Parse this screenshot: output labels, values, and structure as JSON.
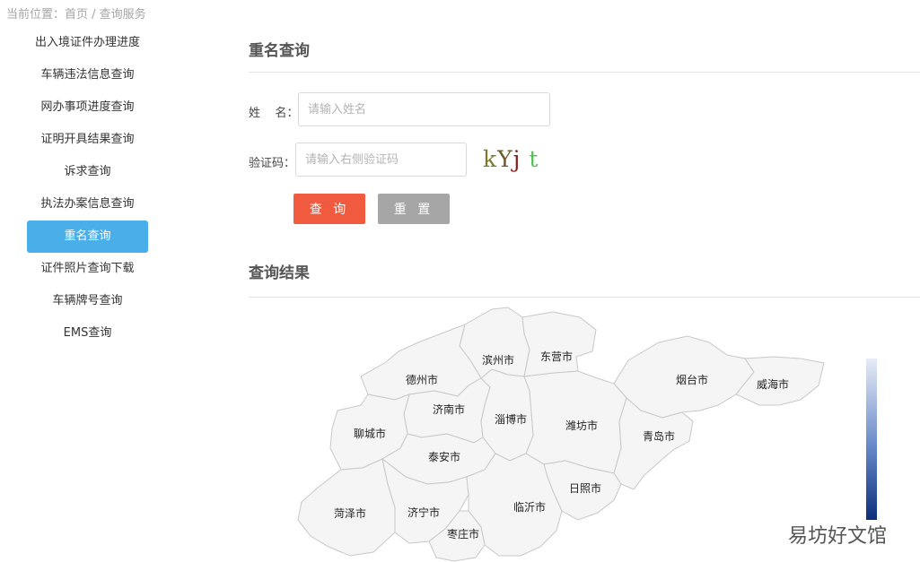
{
  "breadcrumb": {
    "text": "当前位置：首页 / 查询服务"
  },
  "sidebar": {
    "items": [
      {
        "label": "出入境证件办理进度",
        "active": false
      },
      {
        "label": "车辆违法信息查询",
        "active": false
      },
      {
        "label": "网办事项进度查询",
        "active": false
      },
      {
        "label": "证明开具结果查询",
        "active": false
      },
      {
        "label": "诉求查询",
        "active": false
      },
      {
        "label": "执法办案信息查询",
        "active": false
      },
      {
        "label": "重名查询",
        "active": true
      },
      {
        "label": "证件照片查询下载",
        "active": false
      },
      {
        "label": "车辆牌号查询",
        "active": false
      },
      {
        "label": "EMS查询",
        "active": false
      }
    ]
  },
  "main": {
    "title": "重名查询",
    "form": {
      "name_label": "姓    名：",
      "name_placeholder": "请输入姓名",
      "name_value": "",
      "captcha_label": "验证码：",
      "captcha_placeholder": "请输入右侧验证码",
      "captcha_value": "",
      "captcha_chars": [
        {
          "ch": "k",
          "color": "#7a7a2a"
        },
        {
          "ch": "Y",
          "color": "#6a5a2a"
        },
        {
          "ch": "j",
          "color": "#8b1a1a"
        },
        {
          "ch": " ",
          "color": "#ffffff"
        },
        {
          "ch": "t",
          "color": "#4fc24f"
        }
      ]
    },
    "buttons": {
      "query": "查 询",
      "reset": "重 置"
    },
    "results_title": "查询结果"
  },
  "map": {
    "cities": [
      {
        "name": "滨州市"
      },
      {
        "name": "东营市"
      },
      {
        "name": "德州市"
      },
      {
        "name": "烟台市"
      },
      {
        "name": "威海市"
      },
      {
        "name": "济南市"
      },
      {
        "name": "淄博市"
      },
      {
        "name": "聊城市"
      },
      {
        "name": "潍坊市"
      },
      {
        "name": "青岛市"
      },
      {
        "name": "泰安市"
      },
      {
        "name": "日照市"
      },
      {
        "name": "菏泽市"
      },
      {
        "name": "济宁市"
      },
      {
        "name": "临沂市"
      },
      {
        "name": "枣庄市"
      }
    ],
    "colors": {
      "fill": "#f5f5f5",
      "stroke": "#c8c8c8"
    }
  },
  "legend": {
    "colors": {
      "low": "#e7ecf6",
      "high": "#0d2f7a"
    }
  },
  "watermark": {
    "text": "易坊好文馆"
  },
  "colors": {
    "accent": "#4aaee8",
    "query_button": "#f05a3f",
    "reset_button": "#a6a6a6"
  }
}
